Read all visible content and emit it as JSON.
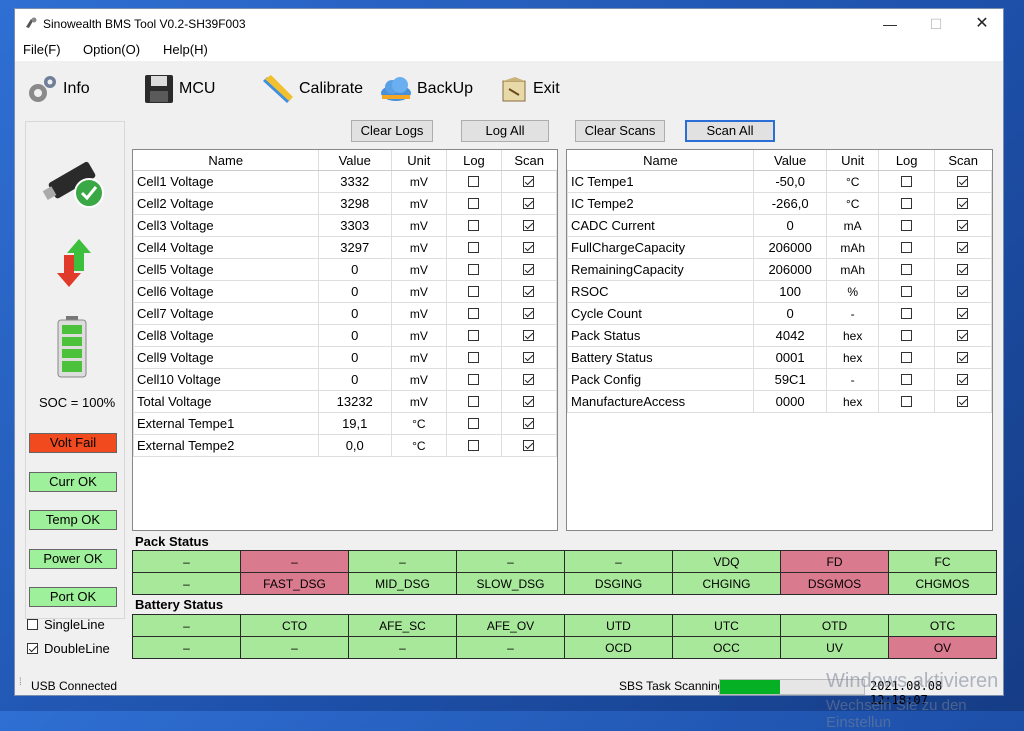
{
  "window": {
    "title": "Sinowealth BMS Tool V0.2-SH39F003"
  },
  "menu": [
    "File(F)",
    "Option(O)",
    "Help(H)"
  ],
  "toolbar": {
    "info": "Info",
    "mcu": "MCU",
    "calibrate": "Calibrate",
    "backup": "BackUp",
    "exit": "Exit"
  },
  "buttons": {
    "clear_logs": "Clear Logs",
    "log_all": "Log All",
    "clear_scans": "Clear Scans",
    "scan_all": "Scan All"
  },
  "left": {
    "soc": "SOC = 100%",
    "statuses": [
      {
        "label": "Volt Fail",
        "color": "#f04a1e"
      },
      {
        "label": "Curr OK",
        "color": "#9ff09a"
      },
      {
        "label": "Temp OK",
        "color": "#9ff09a"
      },
      {
        "label": "Power OK",
        "color": "#9ff09a"
      },
      {
        "label": "Port OK",
        "color": "#9ff09a"
      }
    ],
    "single_line": "SingleLine",
    "double_line": "DoubleLine"
  },
  "table_headers": {
    "name": "Name",
    "value": "Value",
    "unit": "Unit",
    "log": "Log",
    "scan": "Scan"
  },
  "left_table": [
    {
      "name": "Cell1 Voltage",
      "value": "3332",
      "unit": "mV"
    },
    {
      "name": "Cell2 Voltage",
      "value": "3298",
      "unit": "mV"
    },
    {
      "name": "Cell3 Voltage",
      "value": "3303",
      "unit": "mV"
    },
    {
      "name": "Cell4 Voltage",
      "value": "3297",
      "unit": "mV"
    },
    {
      "name": "Cell5 Voltage",
      "value": "0",
      "unit": "mV"
    },
    {
      "name": "Cell6 Voltage",
      "value": "0",
      "unit": "mV"
    },
    {
      "name": "Cell7 Voltage",
      "value": "0",
      "unit": "mV"
    },
    {
      "name": "Cell8 Voltage",
      "value": "0",
      "unit": "mV"
    },
    {
      "name": "Cell9 Voltage",
      "value": "0",
      "unit": "mV"
    },
    {
      "name": "Cell10 Voltage",
      "value": "0",
      "unit": "mV"
    },
    {
      "name": "Total Voltage",
      "value": "13232",
      "unit": "mV"
    },
    {
      "name": "External Tempe1",
      "value": "19,1",
      "unit": "°C"
    },
    {
      "name": "External Tempe2",
      "value": "0,0",
      "unit": "°C"
    }
  ],
  "right_table": [
    {
      "name": "IC Tempe1",
      "value": "-50,0",
      "unit": "°C"
    },
    {
      "name": "IC Tempe2",
      "value": "-266,0",
      "unit": "°C"
    },
    {
      "name": "CADC Current",
      "value": "0",
      "unit": "mA"
    },
    {
      "name": "FullChargeCapacity",
      "value": "206000",
      "unit": "mAh"
    },
    {
      "name": "RemainingCapacity",
      "value": "206000",
      "unit": "mAh"
    },
    {
      "name": "RSOC",
      "value": "100",
      "unit": "%"
    },
    {
      "name": "Cycle Count",
      "value": "0",
      "unit": "-"
    },
    {
      "name": "Pack Status",
      "value": "4042",
      "unit": "hex"
    },
    {
      "name": "Battery Status",
      "value": "0001",
      "unit": "hex"
    },
    {
      "name": "Pack Config",
      "value": "59C1",
      "unit": "-"
    },
    {
      "name": "ManufactureAccess",
      "value": "0000",
      "unit": "hex"
    }
  ],
  "pack_status": {
    "title": "Pack Status",
    "rows": [
      [
        {
          "t": "–",
          "on": false
        },
        {
          "t": "–",
          "on": true
        },
        {
          "t": "–",
          "on": false
        },
        {
          "t": "–",
          "on": false
        },
        {
          "t": "–",
          "on": false
        },
        {
          "t": "VDQ",
          "on": false
        },
        {
          "t": "FD",
          "on": true
        },
        {
          "t": "FC",
          "on": false
        }
      ],
      [
        {
          "t": "–",
          "on": false
        },
        {
          "t": "FAST_DSG",
          "on": true
        },
        {
          "t": "MID_DSG",
          "on": false
        },
        {
          "t": "SLOW_DSG",
          "on": false
        },
        {
          "t": "DSGING",
          "on": false
        },
        {
          "t": "CHGING",
          "on": false
        },
        {
          "t": "DSGMOS",
          "on": true
        },
        {
          "t": "CHGMOS",
          "on": false
        }
      ]
    ]
  },
  "battery_status": {
    "title": "Battery Status",
    "rows": [
      [
        {
          "t": "–",
          "on": false
        },
        {
          "t": "CTO",
          "on": false
        },
        {
          "t": "AFE_SC",
          "on": false
        },
        {
          "t": "AFE_OV",
          "on": false
        },
        {
          "t": "UTD",
          "on": false
        },
        {
          "t": "UTC",
          "on": false
        },
        {
          "t": "OTD",
          "on": false
        },
        {
          "t": "OTC",
          "on": false
        }
      ],
      [
        {
          "t": "–",
          "on": false
        },
        {
          "t": "–",
          "on": false
        },
        {
          "t": "–",
          "on": false
        },
        {
          "t": "–",
          "on": false
        },
        {
          "t": "OCD",
          "on": false
        },
        {
          "t": "OCC",
          "on": false
        },
        {
          "t": "UV",
          "on": false
        },
        {
          "t": "OV",
          "on": true
        }
      ]
    ]
  },
  "statusbar": {
    "connection": "USB Connected",
    "task": "SBS Task Scanning",
    "progress": 0.42,
    "datetime": "2021.08.08 12:18:07"
  },
  "watermark": {
    "line1": "Windows aktivieren",
    "line2": "Wechseln Sie zu den Einstellun"
  },
  "colors": {
    "on": "#d97a8e",
    "off": "#a8e89a"
  }
}
